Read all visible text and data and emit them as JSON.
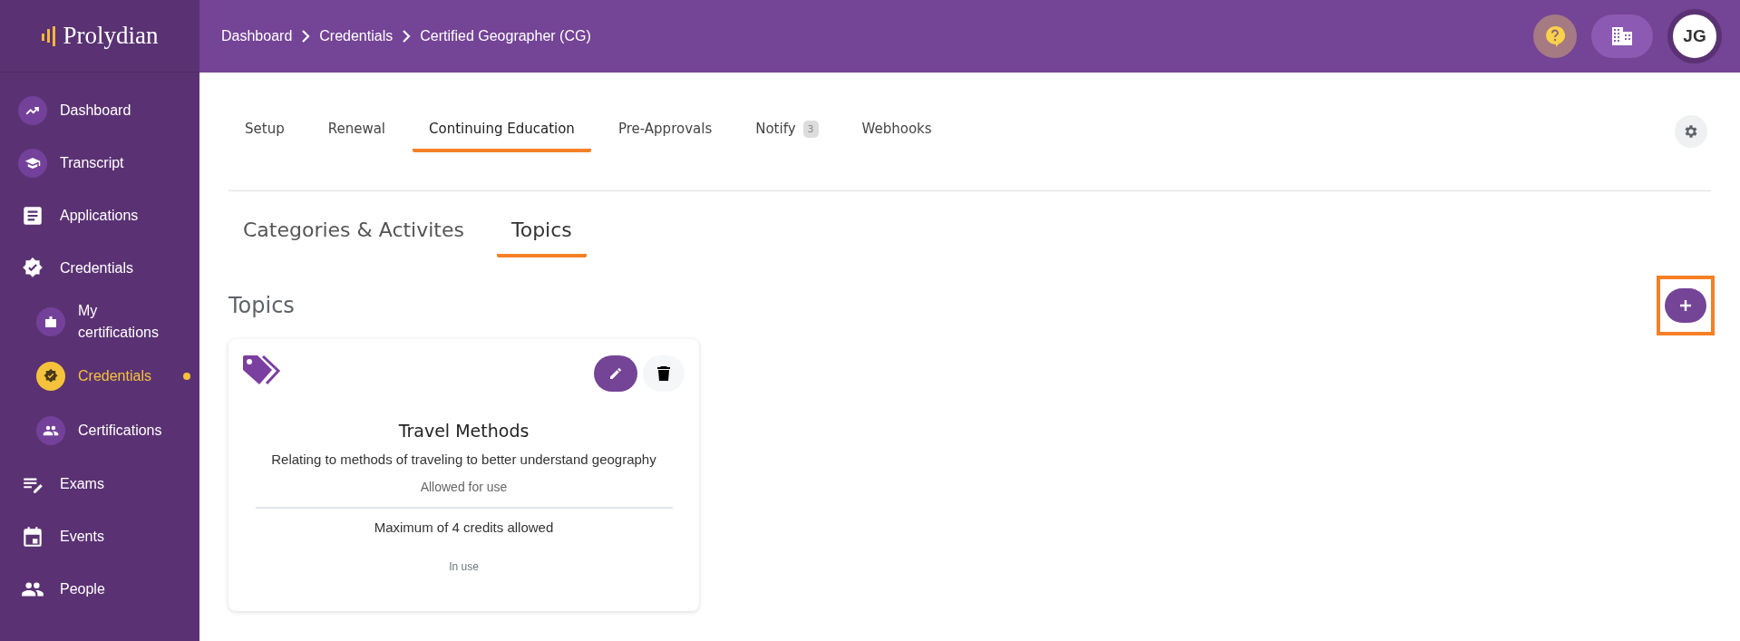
{
  "brand": {
    "name": "Prolydian"
  },
  "breadcrumbs": [
    "Dashboard",
    "Credentials",
    "Certified Geographer (CG)"
  ],
  "header": {
    "avatar": "JG"
  },
  "sidebar": {
    "items": [
      {
        "label": "Dashboard",
        "kind": "badge",
        "selected": false
      },
      {
        "label": "Transcript",
        "kind": "badge",
        "selected": false
      },
      {
        "label": "Applications",
        "kind": "plain",
        "selected": false
      },
      {
        "label": "Credentials",
        "kind": "plain",
        "selected": false,
        "children": [
          {
            "label": "My certifications",
            "kind": "badge",
            "selected": false
          },
          {
            "label": "Credentials",
            "kind": "badge",
            "selected": true
          },
          {
            "label": "Certifications",
            "kind": "badge",
            "selected": false
          }
        ]
      },
      {
        "label": "Exams",
        "kind": "plain",
        "selected": false
      },
      {
        "label": "Events",
        "kind": "plain",
        "selected": false
      },
      {
        "label": "People",
        "kind": "plain",
        "selected": false
      }
    ]
  },
  "tabs": [
    {
      "label": "Setup",
      "selected": false
    },
    {
      "label": "Renewal",
      "selected": false
    },
    {
      "label": "Continuing Education",
      "selected": true
    },
    {
      "label": "Pre-Approvals",
      "selected": false
    },
    {
      "label": "Notify",
      "selected": false,
      "count": "3"
    },
    {
      "label": "Webhooks",
      "selected": false
    }
  ],
  "subtabs": [
    {
      "label": "Categories & Activites",
      "selected": false
    },
    {
      "label": "Topics",
      "selected": true
    }
  ],
  "section": {
    "title": "Topics"
  },
  "topics": [
    {
      "name": "Travel Methods",
      "description": "Relating to methods of traveling to better understand geography",
      "permission": "Allowed for use",
      "limit": "Maximum of 4 credits allowed",
      "status": "In use"
    }
  ]
}
